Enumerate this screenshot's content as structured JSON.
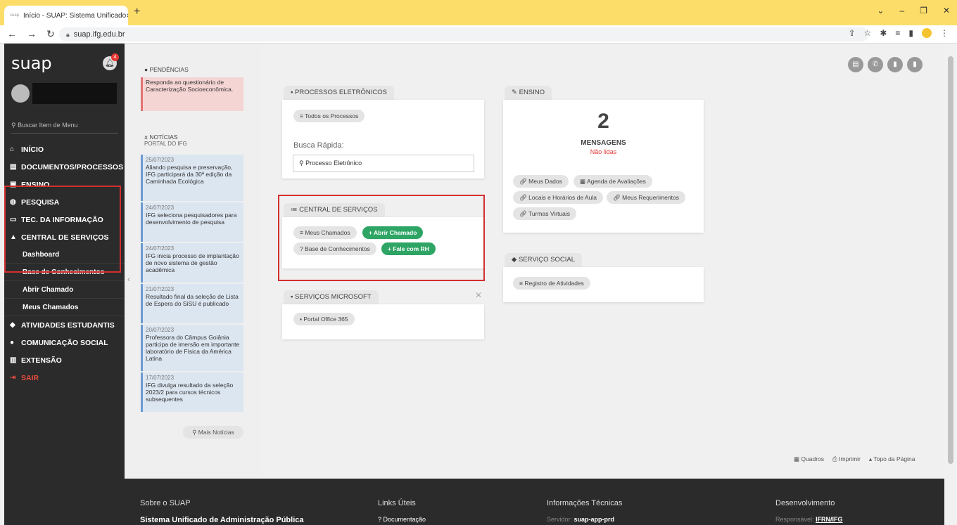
{
  "browser": {
    "tab_title": "Início - SUAP: Sistema Unificado",
    "favicon_text": "suap",
    "new_tab": "+",
    "url": "suap.ifg.edu.br"
  },
  "sidebar": {
    "logo": "suap",
    "notifications": "4",
    "search_placeholder": "Buscar Item de Menu",
    "items": [
      {
        "label": "INÍCIO"
      },
      {
        "label": "DOCUMENTOS/PROCESSOS"
      },
      {
        "label": "ENSINO"
      },
      {
        "label": "PESQUISA"
      },
      {
        "label": "TEC. DA INFORMAÇÃO"
      },
      {
        "label": "CENTRAL DE SERVIÇOS"
      }
    ],
    "central_sub": [
      "Dashboard",
      "Base de Conhecimentos",
      "Abrir Chamado",
      "Meus Chamados"
    ],
    "items2": [
      {
        "label": "ATIVIDADES ESTUDANTIS"
      },
      {
        "label": "COMUNICAÇÃO SOCIAL"
      },
      {
        "label": "EXTENSÃO"
      }
    ],
    "logout": "SAIR"
  },
  "pendencias": {
    "title": "PENDÊNCIAS",
    "text": "Responda ao questionário de Caracterização Socioeconômica."
  },
  "noticias": {
    "title": "NOTÍCIAS",
    "subtitle": "PORTAL DO IFG",
    "items": [
      {
        "date": "25/07/2023",
        "text": "Aliando pesquisa e preservação, IFG participará da 30ª edição da Caminhada Ecológica"
      },
      {
        "date": "24/07/2023",
        "text": "IFG seleciona pesquisadores para desenvolvimento de pesquisa"
      },
      {
        "date": "24/07/2023",
        "text": "IFG inicia processo de implantação de novo sistema de gestão acadêmica"
      },
      {
        "date": "21/07/2023",
        "text": "Resultado final da seleção de Lista de Espera do SiSU é publicado"
      },
      {
        "date": "20/07/2023",
        "text": "Professora do Câmpus Goiânia participa de imersão em importante laboratório de Física da América Latina"
      },
      {
        "date": "17/07/2023",
        "text": "IFG divulga resultado da seleção 2023/2 para cursos técnicos subsequentes"
      }
    ],
    "more": "Mais Notícias"
  },
  "processos": {
    "title": "PROCESSOS ELETRÔNICOS",
    "all": "Todos os Processos",
    "quick_label": "Busca Rápida:",
    "quick_placeholder": "Processo Eletrônico"
  },
  "central": {
    "title": "CENTRAL DE SERVIÇOS",
    "meus": "Meus Chamados",
    "abrir": "Abrir Chamado",
    "base": "Base de Conhecimentos",
    "rh": "Fale com RH"
  },
  "microsoft": {
    "title": "SERVIÇOS MICROSOFT",
    "office": "Portal Office 365"
  },
  "ensino": {
    "title": "ENSINO",
    "count": "2",
    "label": "MENSAGENS",
    "sublabel": "Não lidas",
    "links": [
      "Meus Dados",
      "Agenda de Avaliações",
      "Locais e Horários de Aula",
      "Meus Requerimentos",
      "Turmas Virtuais"
    ]
  },
  "social": {
    "title": "SERVIÇO SOCIAL",
    "registro": "Registro de Atividades"
  },
  "bottom_links": [
    "Quadros",
    "Imprimir",
    "Topo da Página"
  ],
  "footer": {
    "col1_title": "Sobre o SUAP",
    "col1_value": "Sistema Unificado de Administração Pública",
    "col2_title": "Links Úteis",
    "col2_value": "Documentação",
    "col3_title": "Informações Técnicas",
    "col3_prefix": "Servidor:",
    "col3_value": "suap-app-prd",
    "col4_title": "Desenvolvimento",
    "col4_prefix": "Responsável:",
    "col4_value": "IFRN/IFG"
  },
  "colors": {
    "accent_green": "#2ea565",
    "highlight_red": "#d32f2f",
    "chrome_yellow": "#fddd6a"
  }
}
